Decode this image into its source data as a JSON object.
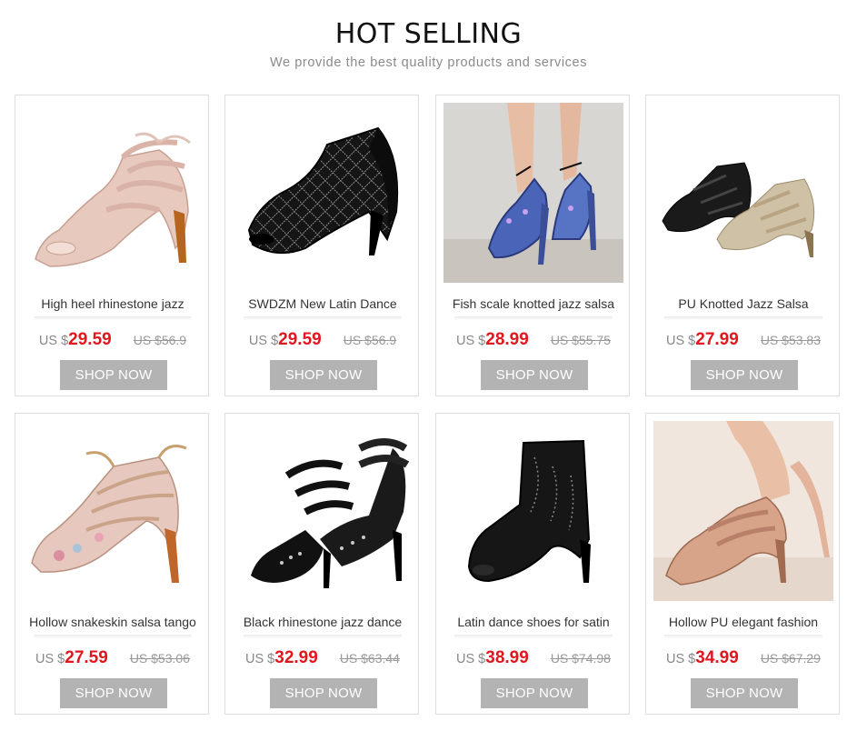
{
  "header": {
    "title": "HOT SELLING",
    "subtitle": "We provide the best quality products and services"
  },
  "products": [
    {
      "name": "High heel rhinestone jazz",
      "currency": "US $",
      "price": "29.59",
      "old_price": "US $56.9",
      "button": "SHOP NOW",
      "image_icon": "pink-lace-up-heel"
    },
    {
      "name": "SWDZM New Latin Dance",
      "currency": "US $",
      "price": "29.59",
      "old_price": "US $56.9",
      "button": "SHOP NOW",
      "image_icon": "black-rhinestone-bootie"
    },
    {
      "name": "Fish scale knotted jazz salsa",
      "currency": "US $",
      "price": "28.99",
      "old_price": "US $55.75",
      "button": "SHOP NOW",
      "image_icon": "blue-scale-heel-photo"
    },
    {
      "name": "PU Knotted Jazz Salsa",
      "currency": "US $",
      "price": "27.99",
      "old_price": "US $53.83",
      "button": "SHOP NOW",
      "image_icon": "strappy-heels-pair"
    },
    {
      "name": "Hollow snakeskin salsa tango",
      "currency": "US $",
      "price": "27.59",
      "old_price": "US $53.06",
      "button": "SHOP NOW",
      "image_icon": "snakeskin-lace-up-heel"
    },
    {
      "name": "Black rhinestone jazz dance",
      "currency": "US $",
      "price": "32.99",
      "old_price": "US $63.44",
      "button": "SHOP NOW",
      "image_icon": "black-strappy-sandals"
    },
    {
      "name": "Latin dance shoes for satin",
      "currency": "US $",
      "price": "38.99",
      "old_price": "US $74.98",
      "button": "SHOP NOW",
      "image_icon": "black-satin-boot"
    },
    {
      "name": "Hollow PU elegant fashion",
      "currency": "US $",
      "price": "34.99",
      "old_price": "US $67.29",
      "button": "SHOP NOW",
      "image_icon": "rose-gold-heel-photo"
    }
  ]
}
